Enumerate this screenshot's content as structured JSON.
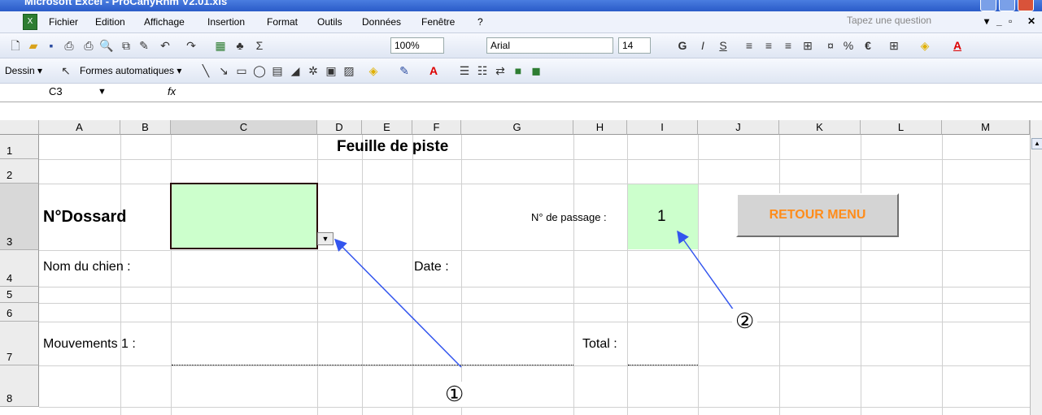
{
  "window": {
    "title": "Microsoft Excel - ProCanyRhm V2.01.xls"
  },
  "menu": {
    "items": [
      "Fichier",
      "Edition",
      "Affichage",
      "Insertion",
      "Format",
      "Outils",
      "Données",
      "Fenêtre",
      "?"
    ],
    "ask_placeholder": "Tapez une question"
  },
  "toolbar": {
    "zoom": "100%",
    "font": "Arial",
    "font_size": "14",
    "bold": "G",
    "italic": "I",
    "underline": "S",
    "euro": "€",
    "percent": "%"
  },
  "drawing_toolbar": {
    "dessin": "Dessin ▾",
    "formes": "Formes automatiques ▾"
  },
  "formula_bar": {
    "name_box": "C3",
    "fx": "fx",
    "value": ""
  },
  "sheet": {
    "columns": [
      "A",
      "B",
      "C",
      "D",
      "E",
      "F",
      "G",
      "H",
      "I",
      "J",
      "K",
      "L",
      "M"
    ],
    "rows": [
      "1",
      "2",
      "3",
      "4",
      "5",
      "6",
      "7",
      "8"
    ],
    "title": "Feuille de piste",
    "dossard_label": "N°Dossard",
    "passage_label": "N° de passage :",
    "passage_value": "1",
    "chien_label": "Nom du chien :",
    "date_label": "Date :",
    "mouvements_label": "Mouvements 1 :",
    "total_label": "Total :",
    "retour_button": "RETOUR  MENU"
  },
  "annotations": {
    "marker_1": "①",
    "marker_2": "②"
  },
  "colors": {
    "selected_cell_fill": "#ccffcc",
    "button_text": "#ff8c1a",
    "annotation_arrow": "#3355ee"
  }
}
